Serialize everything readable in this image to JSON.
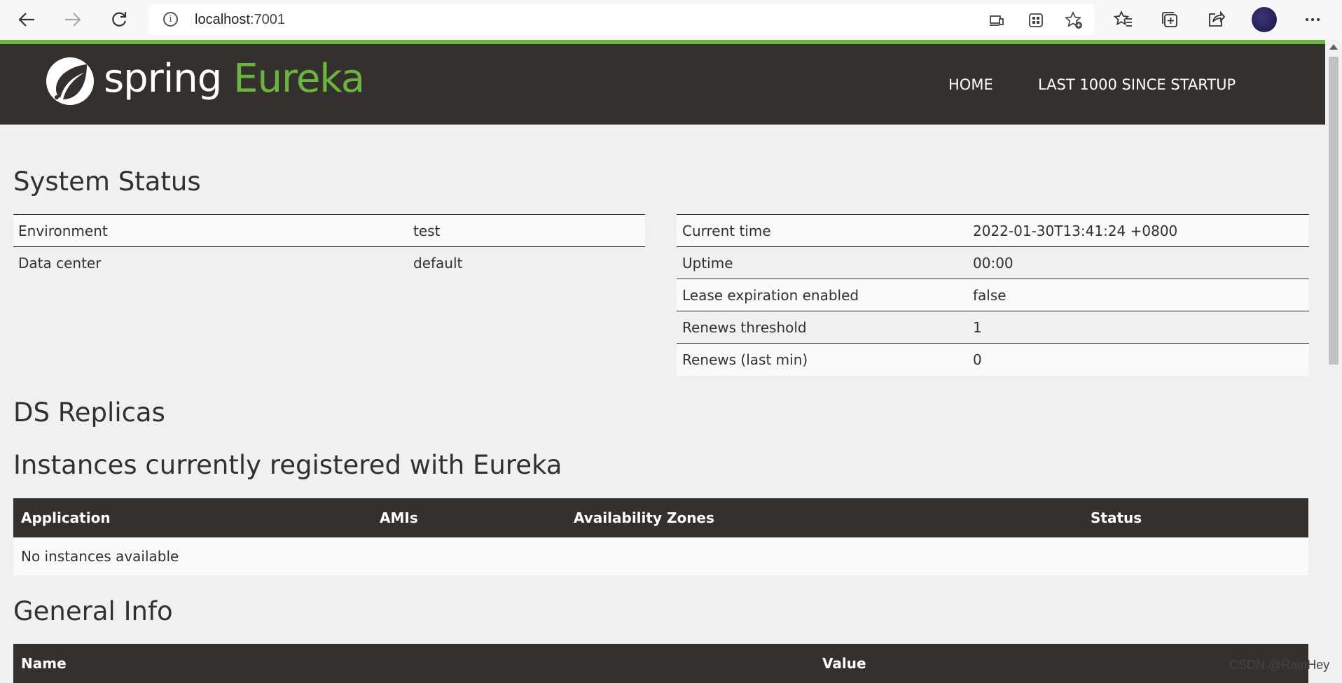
{
  "browser": {
    "url_host": "localhost",
    "url_port": ":7001",
    "icons": [
      "back-icon",
      "forward-icon",
      "refresh-icon",
      "info-icon",
      "device-icon",
      "app-grid-icon",
      "add-favorite-icon",
      "favorites-icon",
      "collections-icon",
      "share-icon",
      "avatar",
      "more-icon"
    ]
  },
  "navbar": {
    "brand_spring": "spring",
    "brand_eureka": "Eureka",
    "home": "HOME",
    "last1000": "LAST 1000 SINCE STARTUP"
  },
  "system_status": {
    "title": "System Status",
    "left": [
      {
        "label": "Environment",
        "value": "test"
      },
      {
        "label": "Data center",
        "value": "default"
      }
    ],
    "right": [
      {
        "label": "Current time",
        "value": "2022-01-30T13:41:24 +0800"
      },
      {
        "label": "Uptime",
        "value": "00:00"
      },
      {
        "label": "Lease expiration enabled",
        "value": "false"
      },
      {
        "label": "Renews threshold",
        "value": "1"
      },
      {
        "label": "Renews (last min)",
        "value": "0"
      }
    ]
  },
  "ds_replicas": {
    "title": "DS Replicas"
  },
  "instances": {
    "title": "Instances currently registered with Eureka",
    "columns": [
      "Application",
      "AMIs",
      "Availability Zones",
      "Status"
    ],
    "empty": "No instances available"
  },
  "general_info": {
    "title": "General Info",
    "columns": [
      "Name",
      "Value"
    ]
  },
  "watermark": "CSDN @RainHey",
  "colors": {
    "accent": "#6db33f",
    "dark": "#34302d",
    "background": "#f0f0f0"
  }
}
